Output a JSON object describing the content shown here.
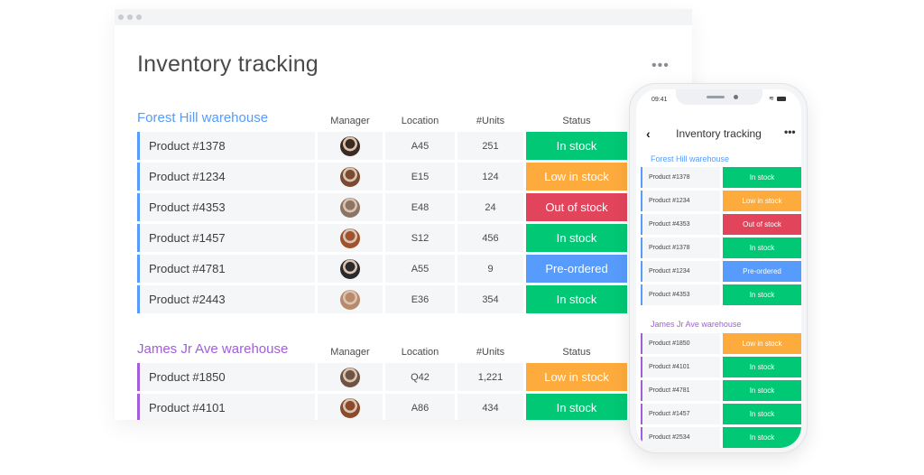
{
  "colors": {
    "in_stock": "#00c875",
    "low_in_stock": "#fdab3d",
    "out_of_stock": "#e2445c",
    "pre_ordered": "#579bfc",
    "group_blue": "#579bfc",
    "group_purple": "#a25ddc"
  },
  "desktop": {
    "title": "Inventory tracking",
    "more_icon": "more-horizontal-icon",
    "columns": {
      "manager": "Manager",
      "location": "Location",
      "units": "#Units",
      "status": "Status"
    },
    "groups": [
      {
        "title": "Forest Hill warehouse",
        "color": "#579bfc",
        "rows": [
          {
            "name": "Product  #1378",
            "location": "A45",
            "units": "251",
            "status": "In stock",
            "status_color": "#00c875",
            "avatar_color": "#3b2a22"
          },
          {
            "name": "Product  #1234",
            "location": "E15",
            "units": "124",
            "status": "Low in stock",
            "status_color": "#fdab3d",
            "avatar_color": "#7a4b32"
          },
          {
            "name": "Product  #4353",
            "location": "E48",
            "units": "24",
            "status": "Out of stock",
            "status_color": "#e2445c",
            "avatar_color": "#8c7466"
          },
          {
            "name": "Product  #1457",
            "location": "S12",
            "units": "456",
            "status": "In stock",
            "status_color": "#00c875",
            "avatar_color": "#a0522d"
          },
          {
            "name": "Product  #4781",
            "location": "A55",
            "units": "9",
            "status": "Pre-ordered",
            "status_color": "#579bfc",
            "avatar_color": "#2b2b2b"
          },
          {
            "name": "Product  #2443",
            "location": "E36",
            "units": "354",
            "status": "In stock",
            "status_color": "#00c875",
            "avatar_color": "#b8896b"
          }
        ]
      },
      {
        "title": "James Jr Ave warehouse",
        "color": "#a25ddc",
        "rows": [
          {
            "name": "Product  #1850",
            "location": "Q42",
            "units": "1,221",
            "status": "Low in stock",
            "status_color": "#fdab3d",
            "avatar_color": "#6d5445"
          },
          {
            "name": "Product  #4101",
            "location": "A86",
            "units": "434",
            "status": "In stock",
            "status_color": "#00c875",
            "avatar_color": "#8b4a2b"
          }
        ]
      }
    ]
  },
  "phone": {
    "time": "09:41",
    "title": "Inventory tracking",
    "back_icon": "chevron-left-icon",
    "more_icon": "more-horizontal-icon",
    "groups": [
      {
        "title": "Forest Hill warehouse",
        "color": "#579bfc",
        "rows": [
          {
            "name": "Product #1378",
            "status": "In stock",
            "status_color": "#00c875"
          },
          {
            "name": "Product  #1234",
            "status": "Low in stock",
            "status_color": "#fdab3d"
          },
          {
            "name": "Product  #4353",
            "status": "Out of stock",
            "status_color": "#e2445c"
          },
          {
            "name": "Product #1378",
            "status": "In stock",
            "status_color": "#00c875"
          },
          {
            "name": "Product  #1234",
            "status": "Pre-ordered",
            "status_color": "#579bfc"
          },
          {
            "name": "Product  #4353",
            "status": "In stock",
            "status_color": "#00c875"
          }
        ]
      },
      {
        "title": "James Jr Ave warehouse",
        "color": "#a25ddc",
        "rows": [
          {
            "name": "Product  #1850",
            "status": "Low in stock",
            "status_color": "#fdab3d"
          },
          {
            "name": "Product  #4101",
            "status": "In stock",
            "status_color": "#00c875"
          },
          {
            "name": "Product  #4781",
            "status": "In stock",
            "status_color": "#00c875"
          },
          {
            "name": "Product  #1457",
            "status": "In stock",
            "status_color": "#00c875"
          },
          {
            "name": "Product  #2534",
            "status": "In stock",
            "status_color": "#00c875"
          }
        ]
      }
    ]
  }
}
